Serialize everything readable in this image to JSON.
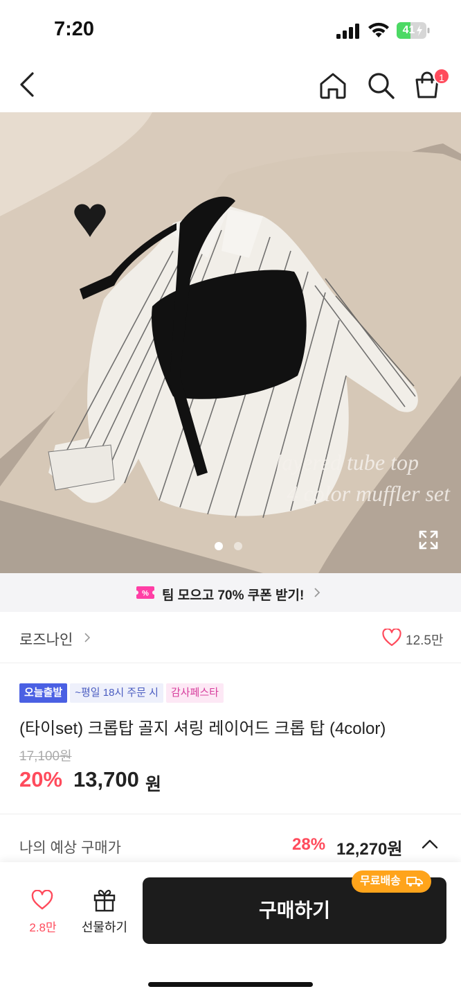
{
  "status_bar": {
    "time": "7:20",
    "battery": "41"
  },
  "nav": {
    "cart_count": "1"
  },
  "hero": {
    "caption_line1": "layered tube top",
    "caption_line2": "4 color muffler set",
    "page_indicator": {
      "current": 1,
      "total": 2
    }
  },
  "coupon": {
    "text": "팀 모으고 70% 쿠폰 받기!",
    "icon": "coupon-percent-icon",
    "accent": "#ff3ea5"
  },
  "seller": {
    "name": "로즈나인",
    "likes": "12.5만"
  },
  "product": {
    "badges": [
      "오늘출발",
      "~평일 18시 주문 시",
      "감사페스타"
    ],
    "title": "(타이set) 크롭탑 골지 셔링 레이어드 크롭 탑 (4color)",
    "original_price": "17,100원",
    "discount_rate": "20%",
    "sale_price": "13,700",
    "sale_price_unit": "원"
  },
  "estimate": {
    "label": "나의 예상 구매가",
    "rate": "28%",
    "price": "12,270원"
  },
  "bottom": {
    "wish_count": "2.8만",
    "gift_label": "선물하기",
    "buy_label": "구매하기",
    "free_shipping": "무료배송"
  },
  "colors": {
    "accent": "#ff4b5c",
    "primary_button": "#1c1c1c",
    "shipping_badge": "#ffa41b",
    "badge_blue": "#4a60e3"
  }
}
